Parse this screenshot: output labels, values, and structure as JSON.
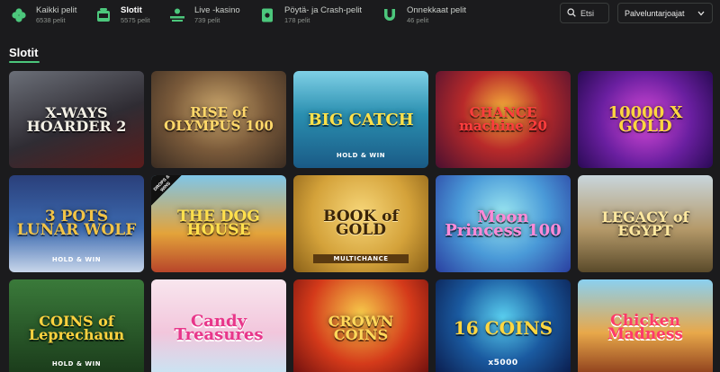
{
  "nav": {
    "categories": [
      {
        "label": "Kaikki pelit",
        "count": "6538 pelit",
        "icon": "clover-icon"
      },
      {
        "label": "Slotit",
        "count": "5575 pelit",
        "icon": "slot-machine-icon"
      },
      {
        "label": "Live -kasino",
        "count": "739 pelit",
        "icon": "croupier-icon"
      },
      {
        "label": "Pöytä- ja Crash-pelit",
        "count": "178 pelit",
        "icon": "cards-icon"
      },
      {
        "label": "Onnekkaat pelit",
        "count": "46 pelit",
        "icon": "horseshoe-icon"
      }
    ],
    "search_placeholder": "Etsi",
    "provider_select": "Palveluntarjoajat"
  },
  "section": {
    "title": "Slotit"
  },
  "games": [
    {
      "name": "X-WAYS HOARDER 2",
      "sub": ""
    },
    {
      "name": "RISE of OLYMPUS 100",
      "sub": ""
    },
    {
      "name": "BIG CATCH",
      "sub": "HOLD & WIN"
    },
    {
      "name": "CHANCE machine 20",
      "sub": ""
    },
    {
      "name": "10000 X GOLD",
      "sub": ""
    },
    {
      "name": "3 POTS LUNAR WOLF",
      "sub": "HOLD & WIN"
    },
    {
      "name": "THE DOG HOUSE",
      "sub": "",
      "badge": "DROPS & WINS"
    },
    {
      "name": "BOOK of GOLD",
      "sub": "MULTICHANCE"
    },
    {
      "name": "Moon Princess 100",
      "sub": ""
    },
    {
      "name": "LEGACY of EGYPT",
      "sub": ""
    },
    {
      "name": "COINS of Leprechaun",
      "sub": "HOLD & WIN"
    },
    {
      "name": "Candy Treasures",
      "sub": ""
    },
    {
      "name": "CROWN COINS",
      "sub": ""
    },
    {
      "name": "16 COINS",
      "sub": "x5000"
    },
    {
      "name": "Chicken Madness",
      "sub": ""
    }
  ],
  "colors": {
    "accent": "#4cc77c",
    "background": "#1b1b1d"
  }
}
